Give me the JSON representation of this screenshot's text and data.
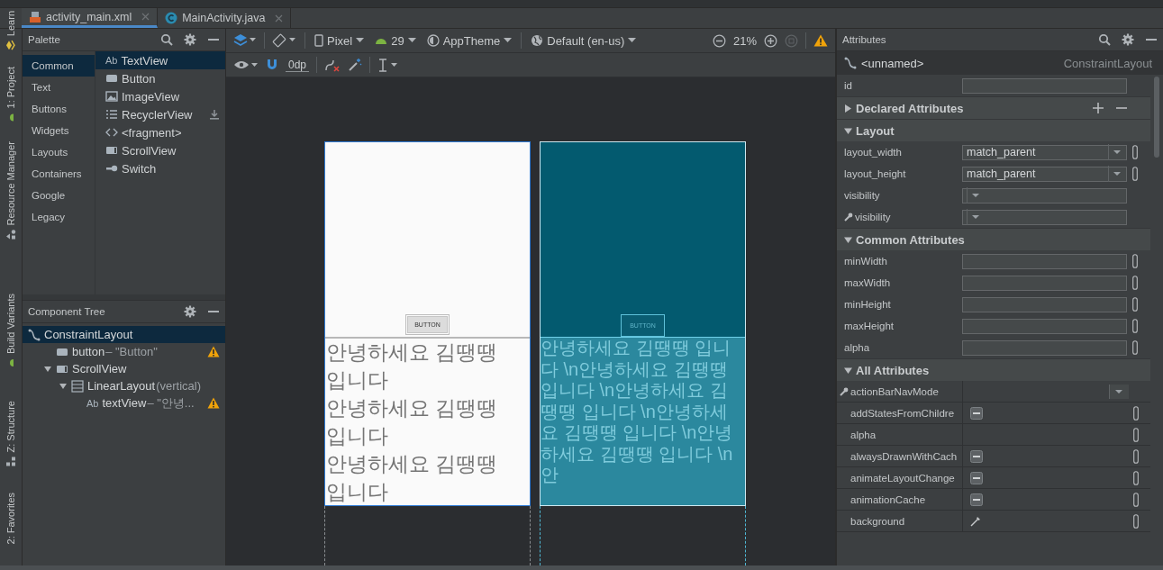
{
  "side_tabs": [
    {
      "label": "Learn",
      "kind": "learn"
    },
    {
      "label": "1: Project",
      "kind": "android"
    },
    {
      "label": "Resource Manager",
      "kind": "shapes"
    },
    {
      "label": "Build Variants",
      "kind": "android"
    },
    {
      "label": "Z: Structure",
      "kind": "structure"
    },
    {
      "label": "2: Favorites",
      "kind": "plain"
    }
  ],
  "editor_tabs": [
    {
      "label": "activity_main.xml",
      "kind": "xml",
      "selected": true
    },
    {
      "label": "MainActivity.java",
      "kind": "class",
      "selected": false
    }
  ],
  "palette": {
    "title": "Palette",
    "categories": [
      {
        "label": "Common",
        "selected": true
      },
      {
        "label": "Text",
        "selected": false
      },
      {
        "label": "Buttons",
        "selected": false
      },
      {
        "label": "Widgets",
        "selected": false
      },
      {
        "label": "Layouts",
        "selected": false
      },
      {
        "label": "Containers",
        "selected": false
      },
      {
        "label": "Google",
        "selected": false
      },
      {
        "label": "Legacy",
        "selected": false
      }
    ],
    "items": [
      {
        "label": "TextView",
        "kind": "text",
        "badge": "Ab",
        "selected": true,
        "download": false
      },
      {
        "label": "Button",
        "kind": "button",
        "selected": false,
        "download": false
      },
      {
        "label": "ImageView",
        "kind": "image",
        "selected": false,
        "download": false
      },
      {
        "label": "RecyclerView",
        "kind": "list",
        "selected": false,
        "download": true
      },
      {
        "label": "<fragment>",
        "kind": "code",
        "selected": false,
        "download": false
      },
      {
        "label": "ScrollView",
        "kind": "scroll",
        "selected": false,
        "download": false
      },
      {
        "label": "Switch",
        "kind": "switch",
        "selected": false,
        "download": false
      }
    ]
  },
  "component_tree": {
    "title": "Component Tree",
    "items": [
      {
        "label": "ConstraintLayout",
        "kind": "constraint",
        "selected": true,
        "warning": false,
        "children": [
          {
            "label": "button",
            "detail": "– \"Button\"",
            "kind": "button",
            "selected": false,
            "warning": true
          },
          {
            "label": "ScrollView",
            "kind": "scroll",
            "selected": false,
            "warning": false,
            "expanded": true,
            "children": [
              {
                "label": "LinearLayout",
                "detail": "(vertical)",
                "kind": "linear",
                "selected": false,
                "warning": false,
                "expanded": true,
                "children": [
                  {
                    "label": "textView",
                    "detail": "– \"안녕...",
                    "kind": "text",
                    "badge": "Ab",
                    "selected": false,
                    "warning": true
                  }
                ]
              }
            ]
          }
        ]
      }
    ]
  },
  "design_toolbar": {
    "device": "Pixel",
    "api": "29",
    "theme": "AppTheme",
    "locale": "Default (en-us)",
    "zoom": "21%",
    "margin": "0dp"
  },
  "preview": {
    "button_label": "BUTTON",
    "text_lines": [
      "안녕하세요 김땡땡",
      "입니다",
      "안녕하세요 김땡땡",
      "입니다",
      "안녕하세요 김땡땡",
      "입니다"
    ]
  },
  "blueprint": {
    "button_label": "BUTTON",
    "text": "안녕하세요 김땡땡 입니다 \\n안녕하세요 김땡땡 입니다 \\n안녕하세요 김땡땡 입니다 \\n안녕하세요 김땡땡 입니다 \\n안녕하세요 김땡땡 입니다 \\n안"
  },
  "attributes": {
    "title": "Attributes",
    "component_name": "<unnamed>",
    "component_type": "ConstraintLayout",
    "id_label": "id",
    "sections": [
      {
        "title": "Declared Attributes",
        "expanded": false,
        "actions": true
      },
      {
        "title": "Layout",
        "expanded": true,
        "actions": false,
        "rows": [
          {
            "name": "layout_width",
            "kind": "dropdown",
            "value": "match_parent",
            "resource": true,
            "design_time": false
          },
          {
            "name": "layout_height",
            "kind": "dropdown",
            "value": "match_parent",
            "resource": true,
            "design_time": false
          },
          {
            "name": "visibility",
            "kind": "dropdown",
            "resource": false,
            "design_time": false
          },
          {
            "name": "visibility",
            "kind": "dropdown",
            "resource": false,
            "design_time": true
          }
        ]
      },
      {
        "title": "Common Attributes",
        "expanded": true,
        "actions": false,
        "rows": [
          {
            "name": "minWidth",
            "kind": "text",
            "resource": true,
            "design_time": false
          },
          {
            "name": "maxWidth",
            "kind": "text",
            "resource": true,
            "design_time": false
          },
          {
            "name": "minHeight",
            "kind": "text",
            "resource": true,
            "design_time": false
          },
          {
            "name": "maxHeight",
            "kind": "text",
            "resource": true,
            "design_time": false
          },
          {
            "name": "alpha",
            "kind": "text",
            "resource": true,
            "design_time": false
          }
        ]
      },
      {
        "title": "All Attributes",
        "expanded": true,
        "actions": false,
        "rows": [
          {
            "name": "actionBarNavMode",
            "kind": "combo",
            "resource": false,
            "design_time": true
          },
          {
            "name": "addStatesFromChildre",
            "kind": "flag",
            "resource": true,
            "design_time": false
          },
          {
            "name": "alpha",
            "kind": "blank",
            "resource": true,
            "design_time": false
          },
          {
            "name": "alwaysDrawnWithCach",
            "kind": "flag",
            "resource": true,
            "design_time": false
          },
          {
            "name": "animateLayoutChange",
            "kind": "flag",
            "resource": true,
            "design_time": false
          },
          {
            "name": "animationCache",
            "kind": "flag",
            "resource": true,
            "design_time": false
          },
          {
            "name": "background",
            "kind": "color",
            "resource": true,
            "design_time": false
          }
        ]
      }
    ]
  }
}
